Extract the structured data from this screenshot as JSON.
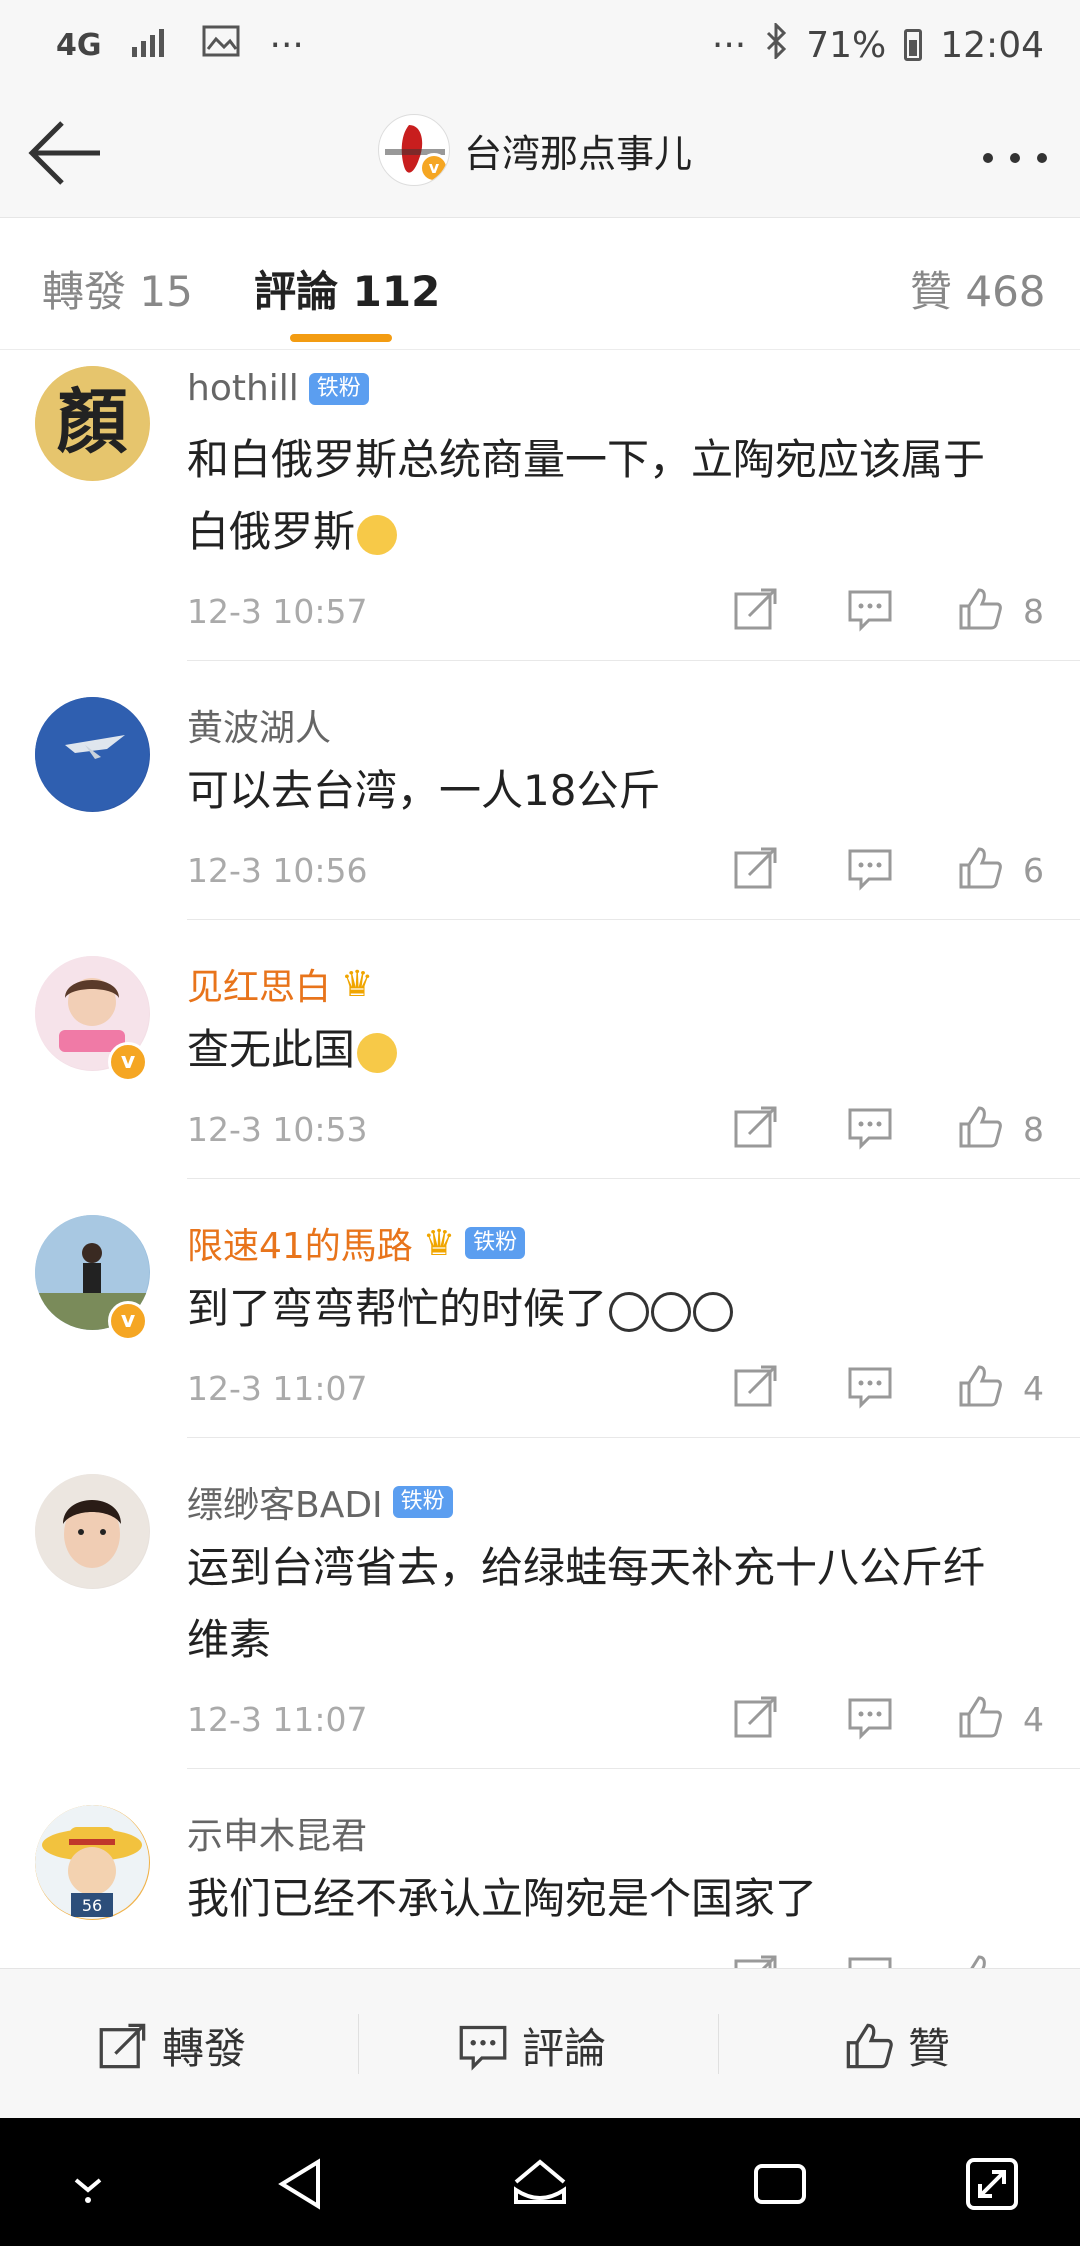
{
  "status_bar": {
    "network": "4G",
    "battery": "71%",
    "time": "12:04",
    "left_more": "···",
    "right_more": "···"
  },
  "header": {
    "title": "台湾那点事儿"
  },
  "tabs": {
    "repost": "轉發 15",
    "comment": "評論 112",
    "like": "贊 468"
  },
  "comments": [
    {
      "username": "hothill",
      "badge": "铁粉",
      "text_lines": [
        "和白俄罗斯总统商量一下，立陶宛应该属于",
        "白俄罗斯"
      ],
      "time": "12-3 10:57",
      "likes": "8"
    },
    {
      "username": "黄波湖人",
      "text_lines": [
        "可以去台湾，一人18公斤"
      ],
      "time": "12-3 10:56",
      "likes": "6"
    },
    {
      "username": "见红思白",
      "text_lines": [
        "查无此国"
      ],
      "time": "12-3 10:53",
      "likes": "8"
    },
    {
      "username": "限速41的馬路",
      "badge": "铁粉",
      "text_lines": [
        "到了弯弯帮忙的时候了"
      ],
      "time": "12-3 11:07",
      "likes": "4"
    },
    {
      "username": "缥缈客BADI",
      "badge": "铁粉",
      "text_lines": [
        "运到台湾省去，给绿蛙每天补充十八公斤纤",
        "维素"
      ],
      "time": "12-3 11:07",
      "likes": "4"
    },
    {
      "username": "示申木昆君",
      "text_lines": [
        "我们已经不承认立陶宛是个国家了"
      ]
    }
  ],
  "bottom_bar": {
    "repost": "轉發",
    "comment": "評論",
    "like": "贊"
  },
  "avatar_0_text": "顏",
  "avatar_4_number": "56"
}
